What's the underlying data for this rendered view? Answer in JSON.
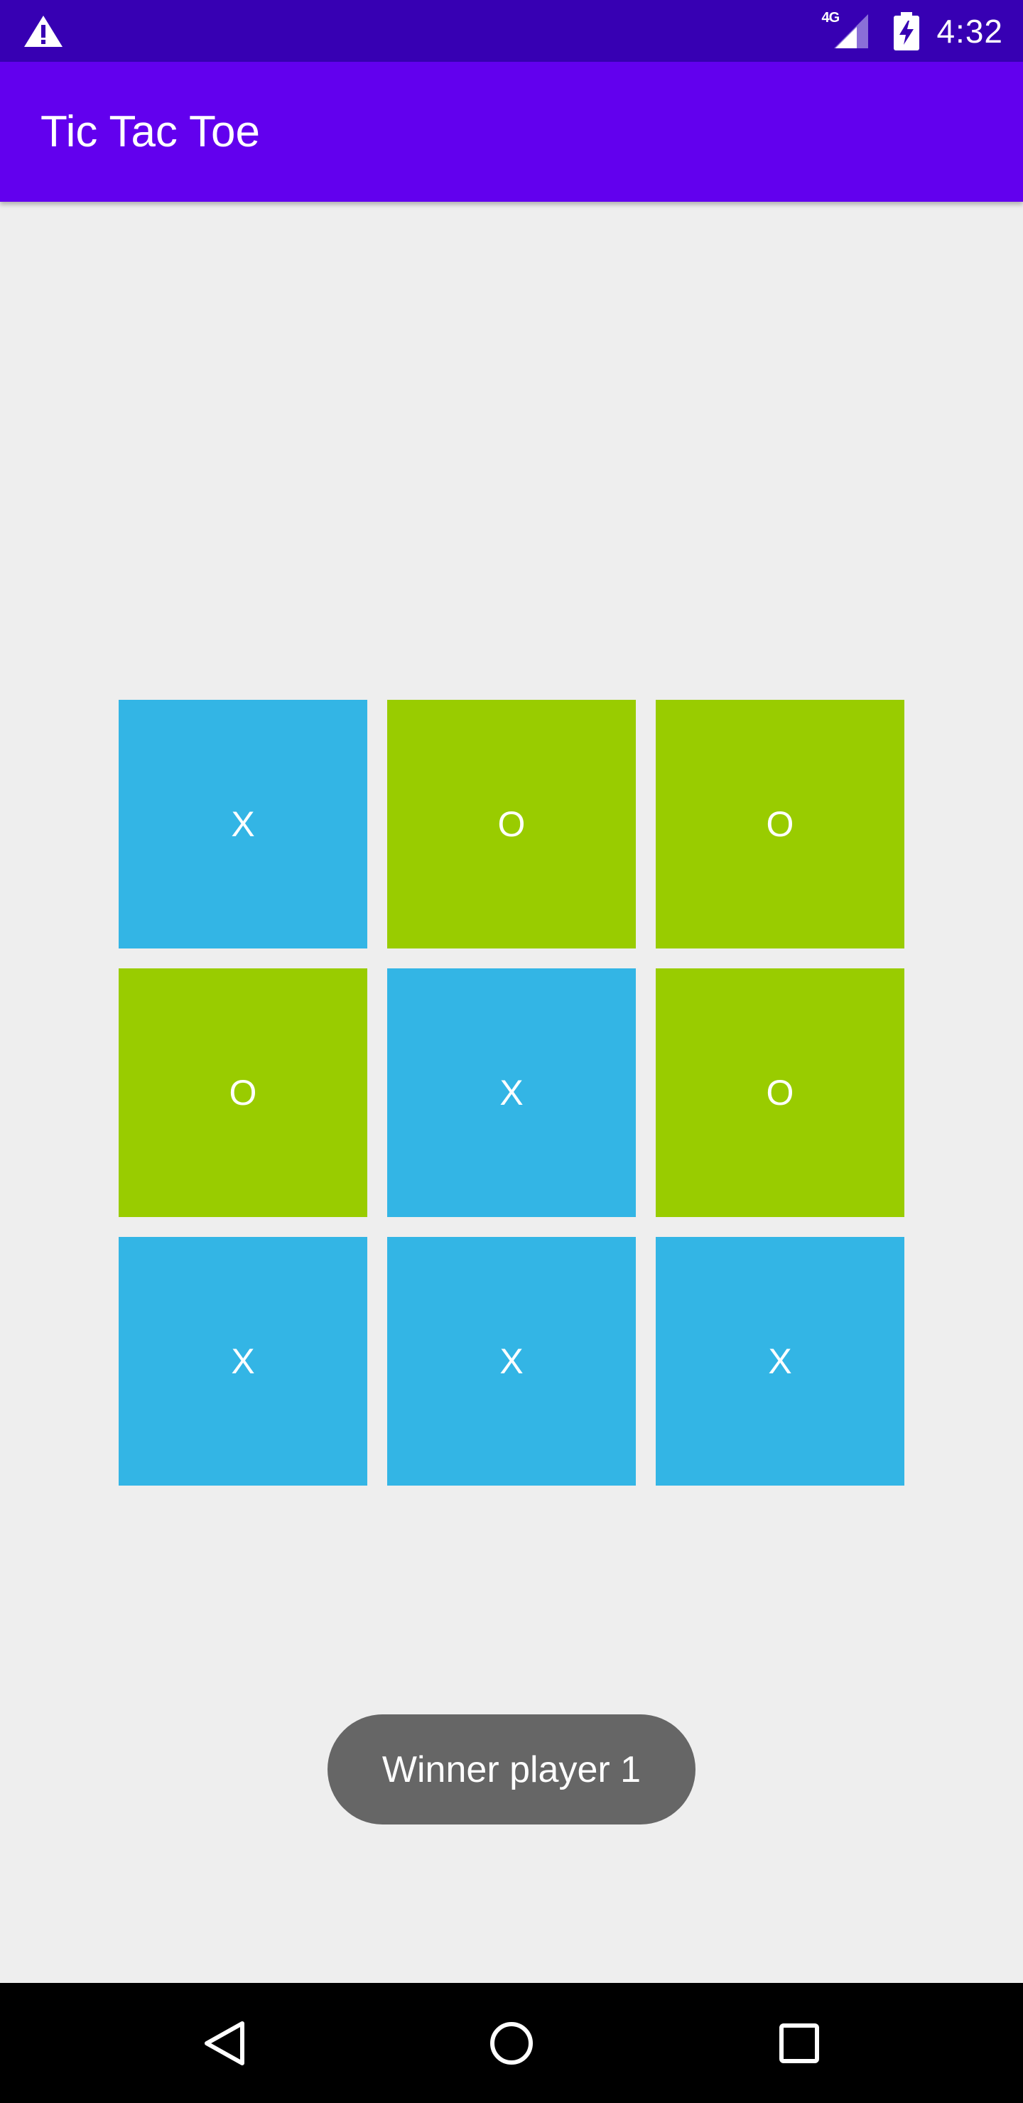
{
  "status_bar": {
    "network": "4G",
    "time": "4:32",
    "icons": [
      "warning-icon",
      "signal-icon",
      "battery-charging-icon"
    ]
  },
  "app_bar": {
    "title": "Tic Tac Toe"
  },
  "board": {
    "cells": [
      "X",
      "O",
      "O",
      "O",
      "X",
      "O",
      "X",
      "X",
      "X"
    ],
    "colors": {
      "x": "#33b5e5",
      "o": "#99cc00"
    }
  },
  "toast": {
    "message": "Winner player 1"
  },
  "nav_bar": {
    "icons": [
      "back-icon",
      "home-icon",
      "recents-icon"
    ]
  },
  "theme": {
    "status_bar": "#3700b3",
    "app_bar": "#6200ee",
    "background": "#eeeeee",
    "toast": "#666666"
  }
}
